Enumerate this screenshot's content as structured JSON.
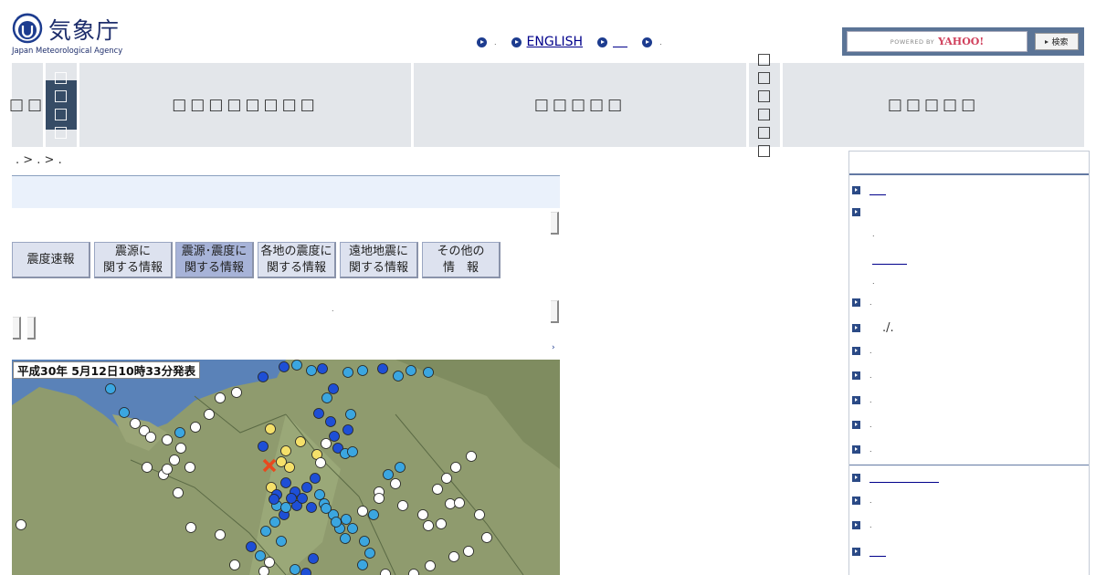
{
  "header": {
    "logo_jp": "気象庁",
    "logo_en": "Japan Meteorological Agency",
    "toplinks": [
      {
        "label": "",
        "sep": "."
      },
      {
        "label": "ENGLISH",
        "sep": ""
      },
      {
        "label": "",
        "sep": ""
      },
      {
        "label": "",
        "sep": "."
      }
    ],
    "search": {
      "powered_by": "POWERED BY",
      "brand": "YAHOO!",
      "button_label": "検索"
    }
  },
  "nav": {
    "items": [
      {
        "label": "□□"
      },
      {
        "label": "□□□□"
      },
      {
        "label": "□□□□□□□□"
      },
      {
        "label": "□□□□□"
      },
      {
        "label": "□□□□□□"
      },
      {
        "label": "□□□□□"
      }
    ]
  },
  "breadcrumb": {
    "text": ". > . > ."
  },
  "tabs": [
    {
      "label_line1": "震度速報",
      "label_line2": ""
    },
    {
      "label_line1": "震源に",
      "label_line2": "関する情報"
    },
    {
      "label_line1": "震源･震度に",
      "label_line2": "関する情報"
    },
    {
      "label_line1": "各地の震度に",
      "label_line2": "関する情報"
    },
    {
      "label_line1": "遠地地震に",
      "label_line2": "関する情報"
    },
    {
      "label_line1": "その他の",
      "label_line2": "情　報"
    }
  ],
  "map": {
    "badge": "平成30年 5月12日10時33分発表",
    "colors": {
      "land": "#8f9b6e",
      "sea": "#5a82b8",
      "epicenter": "#e8491d",
      "intensity_4": "#f5e06a",
      "intensity_3": "#1e4fd6",
      "intensity_2": "#3ba6e0",
      "intensity_1": "#ffffff"
    }
  },
  "sidebar": {
    "items": [
      {
        "text": ""
      },
      {
        "text": ""
      },
      {
        "text": "."
      },
      {
        "text": ""
      },
      {
        "text": "."
      },
      {
        "text": "."
      },
      {
        "text": "./."
      },
      {
        "text": "."
      },
      {
        "text": "."
      },
      {
        "text": "."
      },
      {
        "text": "."
      },
      {
        "text": "."
      },
      {
        "text": ""
      },
      {
        "text": "."
      },
      {
        "text": "."
      },
      {
        "text": ""
      }
    ]
  }
}
